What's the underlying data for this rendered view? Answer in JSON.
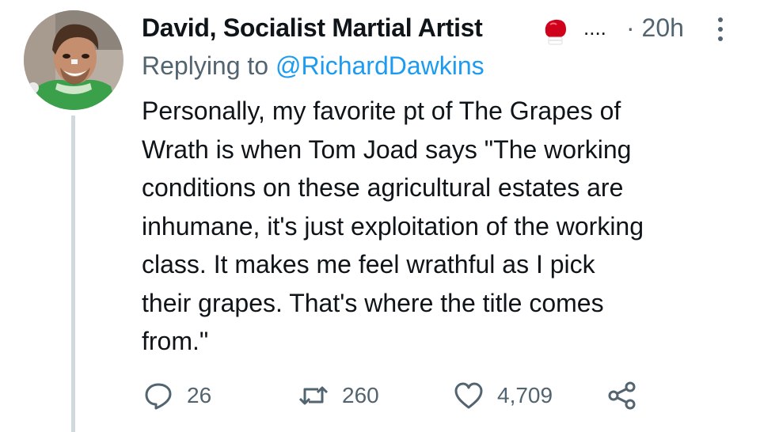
{
  "tweet": {
    "author": {
      "display_name": "David, Socialist Martial Artist",
      "emoji_icon": "boxing-glove-icon",
      "truncation": "....",
      "timestamp": "· 20h"
    },
    "reply": {
      "prefix": "Replying to ",
      "mention": "@RichardDawkins"
    },
    "text_lines": [
      "Personally, my favorite pt of The Grapes of",
      "Wrath is when Tom Joad says \"The working",
      "conditions on these agricultural estates are",
      "inhumane, it's just exploitation of the working",
      "class. It makes me feel wrathful as I pick",
      "their grapes. That's where the title comes",
      "from.\""
    ],
    "actions": {
      "replies": "26",
      "retweets": "260",
      "likes": "4,709"
    }
  },
  "colors": {
    "text": "#0f1419",
    "secondary": "#536471",
    "link": "#1d9bf0",
    "thread_line": "#cfd9de",
    "glove": "#d0021b"
  },
  "icons": [
    "avatar-photo",
    "boxing-glove-icon",
    "more-vertical-icon",
    "reply-icon",
    "retweet-icon",
    "like-icon",
    "share-icon"
  ]
}
